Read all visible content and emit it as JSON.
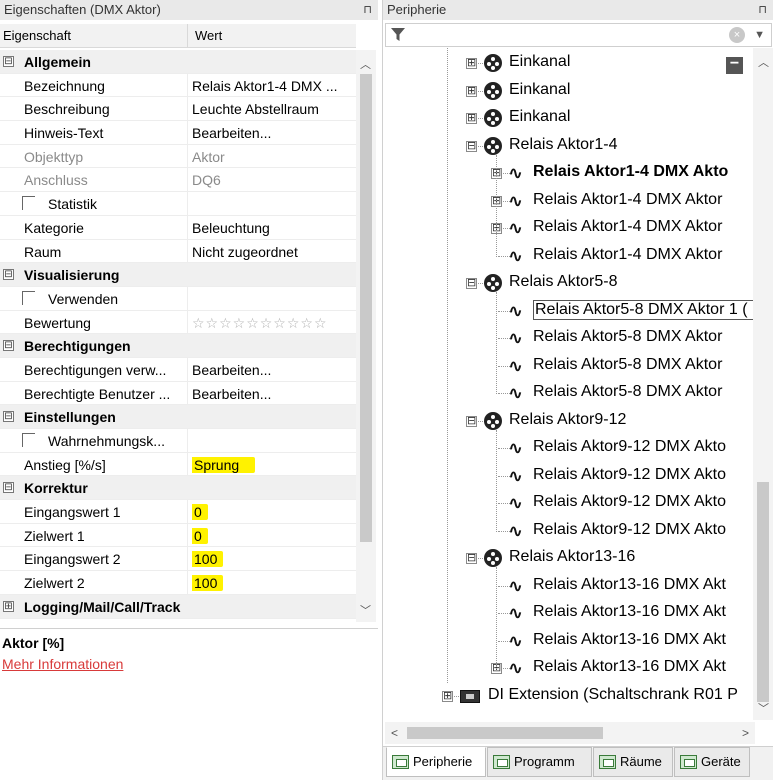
{
  "left_panel": {
    "title": "Eigenschaften (DMX Aktor)",
    "pin": "⊓",
    "header": {
      "col1": "Eigenschaft",
      "col2": "Wert"
    },
    "rows": [
      {
        "type": "category",
        "toggle": "⊟",
        "label": "Allgemein"
      },
      {
        "type": "prop",
        "key": "Bezeichnung",
        "value": "Relais Aktor1-4 DMX ..."
      },
      {
        "type": "prop",
        "key": "Beschreibung",
        "value": "Leuchte Abstellraum"
      },
      {
        "type": "prop",
        "key": "Hinweis-Text",
        "value": "Bearbeiten..."
      },
      {
        "type": "prop",
        "key": "Objekttyp",
        "value": "Aktor",
        "muted": true
      },
      {
        "type": "prop",
        "key": "Anschluss",
        "value": "DQ6",
        "muted": true
      },
      {
        "type": "check",
        "key": "Statistik",
        "value": ""
      },
      {
        "type": "prop",
        "key": "Kategorie",
        "value": "Beleuchtung"
      },
      {
        "type": "prop",
        "key": "Raum",
        "value": "Nicht zugeordnet"
      },
      {
        "type": "category",
        "toggle": "⊟",
        "label": "Visualisierung"
      },
      {
        "type": "check",
        "key": "Verwenden",
        "value": ""
      },
      {
        "type": "rating",
        "key": "Bewertung",
        "value": "☆☆☆☆☆☆☆☆☆☆",
        "rating": 0
      },
      {
        "type": "category",
        "toggle": "⊟",
        "label": "Berechtigungen"
      },
      {
        "type": "prop",
        "key": "Berechtigungen verw...",
        "value": "Bearbeiten..."
      },
      {
        "type": "prop",
        "key": "Berechtigte Benutzer ...",
        "value": "Bearbeiten..."
      },
      {
        "type": "category",
        "toggle": "⊟",
        "label": "Einstellungen"
      },
      {
        "type": "check",
        "key": "Wahrnehmungsk...",
        "value": ""
      },
      {
        "type": "prop",
        "key": "Anstieg [%/s]",
        "value": "Sprung",
        "highlight": true,
        "wide": true
      },
      {
        "type": "category",
        "toggle": "⊟",
        "label": "Korrektur"
      },
      {
        "type": "prop",
        "key": "Eingangswert 1",
        "value": "0",
        "highlight": true
      },
      {
        "type": "prop",
        "key": "Zielwert 1",
        "value": "0",
        "highlight": true
      },
      {
        "type": "prop",
        "key": "Eingangswert 2",
        "value": "100",
        "highlight": true
      },
      {
        "type": "prop",
        "key": "Zielwert 2",
        "value": "100",
        "highlight": true
      },
      {
        "type": "category",
        "toggle": "⊞",
        "label": "Logging/Mail/Call/Track"
      }
    ],
    "scroll_up": "︿",
    "scroll_down": "﹀",
    "description": {
      "title": "Aktor [%]",
      "link": "Mehr Informationen"
    },
    "colors": {
      "highlight": "#fff200",
      "link": "#d83a3a",
      "category_bg": "#f0f0f0"
    }
  },
  "right_panel": {
    "title": "Peripherie",
    "pin": "⊓",
    "filter": {
      "icon": "filter-icon",
      "clear": "×",
      "dropdown": "▼"
    },
    "collapse_button": "−",
    "tree": [
      {
        "level": 0,
        "toggle": "⊞",
        "icon": "dmx-icon",
        "label": "Einkanal"
      },
      {
        "level": 0,
        "toggle": "⊞",
        "icon": "dmx-icon",
        "label": "Einkanal"
      },
      {
        "level": 0,
        "toggle": "⊞",
        "icon": "dmx-icon",
        "label": "Einkanal"
      },
      {
        "level": 0,
        "toggle": "⊟",
        "icon": "dmx-icon",
        "label": "Relais Aktor1-4"
      },
      {
        "level": 1,
        "toggle": "⊞",
        "icon": "wave-icon",
        "label": "Relais Aktor1-4 DMX Akto",
        "bold": true
      },
      {
        "level": 1,
        "toggle": "⊞",
        "icon": "wave-icon",
        "label": "Relais Aktor1-4 DMX Aktor"
      },
      {
        "level": 1,
        "toggle": "⊞",
        "icon": "wave-icon",
        "label": "Relais Aktor1-4 DMX Aktor"
      },
      {
        "level": 1,
        "toggle": "",
        "icon": "wave-icon",
        "label": "Relais Aktor1-4 DMX Aktor"
      },
      {
        "level": 0,
        "toggle": "⊟",
        "icon": "dmx-icon",
        "label": "Relais Aktor5-8"
      },
      {
        "level": 1,
        "toggle": "",
        "icon": "wave-icon",
        "label": "Relais Aktor5-8 DMX Aktor 1 (",
        "selected": true
      },
      {
        "level": 1,
        "toggle": "",
        "icon": "wave-icon",
        "label": "Relais Aktor5-8 DMX Aktor"
      },
      {
        "level": 1,
        "toggle": "",
        "icon": "wave-icon",
        "label": "Relais Aktor5-8 DMX Aktor"
      },
      {
        "level": 1,
        "toggle": "",
        "icon": "wave-icon",
        "label": "Relais Aktor5-8 DMX Aktor"
      },
      {
        "level": 0,
        "toggle": "⊟",
        "icon": "dmx-icon",
        "label": "Relais Aktor9-12"
      },
      {
        "level": 1,
        "toggle": "",
        "icon": "wave-icon",
        "label": "Relais Aktor9-12 DMX Akto"
      },
      {
        "level": 1,
        "toggle": "",
        "icon": "wave-icon",
        "label": "Relais Aktor9-12 DMX Akto"
      },
      {
        "level": 1,
        "toggle": "",
        "icon": "wave-icon",
        "label": "Relais Aktor9-12 DMX Akto"
      },
      {
        "level": 1,
        "toggle": "",
        "icon": "wave-icon",
        "label": "Relais Aktor9-12 DMX Akto"
      },
      {
        "level": 0,
        "toggle": "⊟",
        "icon": "dmx-icon",
        "label": "Relais Aktor13-16"
      },
      {
        "level": 1,
        "toggle": "",
        "icon": "wave-icon",
        "label": "Relais Aktor13-16 DMX Akt"
      },
      {
        "level": 1,
        "toggle": "",
        "icon": "wave-icon",
        "label": "Relais Aktor13-16 DMX Akt"
      },
      {
        "level": 1,
        "toggle": "",
        "icon": "wave-icon",
        "label": "Relais Aktor13-16 DMX Akt"
      },
      {
        "level": 1,
        "toggle": "⊞",
        "icon": "wave-icon",
        "label": "Relais Aktor13-16 DMX Akt"
      },
      {
        "level": -1,
        "toggle": "⊞",
        "icon": "disk-icon",
        "label": "DI Extension (Schaltschrank R01 P"
      }
    ],
    "wave_glyph": "∿",
    "scroll": {
      "up": "︿",
      "down": "﹀",
      "left": "<",
      "right": ">"
    },
    "tabs": [
      {
        "label": "Peripherie",
        "active": true
      },
      {
        "label": "Programm",
        "active": false
      },
      {
        "label": "Räume",
        "active": false
      },
      {
        "label": "Geräte",
        "active": false
      }
    ]
  }
}
